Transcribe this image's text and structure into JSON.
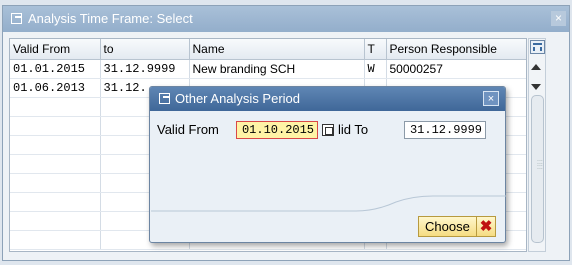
{
  "main_window": {
    "title": "Analysis Time Frame: Select",
    "close_glyph": "×"
  },
  "table": {
    "columns": [
      "Valid From",
      "to",
      "Name",
      "T",
      "Person Responsible"
    ],
    "rows": [
      [
        "01.01.2015",
        "31.12.9999",
        "New branding SCH",
        "W",
        "50000257"
      ],
      [
        "01.06.2013",
        "31.12.",
        "",
        "",
        ""
      ]
    ],
    "empty_rows": 8
  },
  "dialog": {
    "title": "Other Analysis Period",
    "close_glyph": "×",
    "valid_from_label": "Valid From",
    "valid_from_value": "01.10.2015",
    "valid_to_label": "lid To",
    "valid_to_value": "31.12.9999",
    "choose_label": "Choose",
    "cancel_glyph": "✖"
  },
  "icons": {
    "window": "window-icon",
    "settings": "table-settings-icon",
    "value_help": "value-help-icon"
  },
  "colors": {
    "dialog_title": "#3f6798",
    "focus_field": "#fff3a6",
    "button": "#f5dc82",
    "cancel": "#c01010"
  }
}
